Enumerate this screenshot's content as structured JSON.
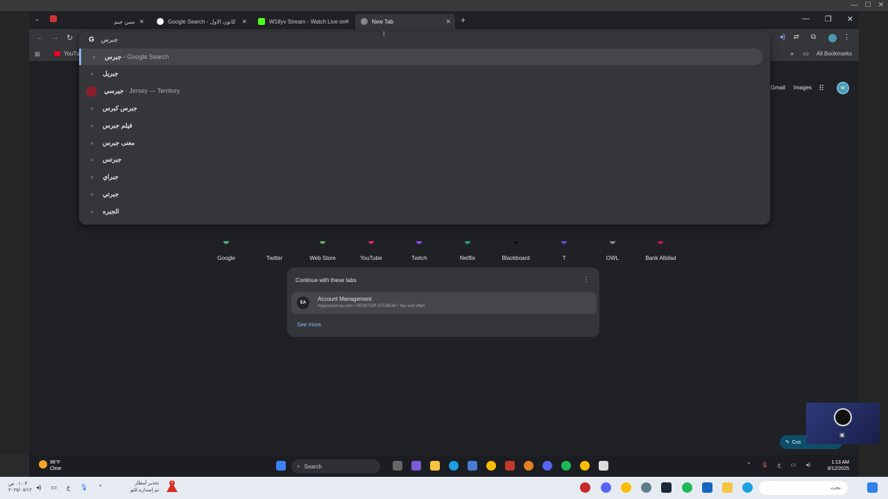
{
  "browser": {
    "tabs": [
      {
        "title": "سين جيم"
      },
      {
        "title": "Google Search - كانون الاول"
      },
      {
        "title": "W18yv Stream - Watch Live on"
      },
      {
        "title": "New Tab"
      }
    ],
    "bookmarks": {
      "youtube": "YouTu",
      "all": "All Bookmarks"
    }
  },
  "omnibox": {
    "query": "جبرس",
    "suggestions": [
      {
        "main": "جبرس",
        "suffix": " - Google Search",
        "icon": "search-icon"
      },
      {
        "main": "جبريل",
        "suffix": "",
        "icon": "search-icon"
      },
      {
        "main": "جيرسي",
        "suffix": " - Jersey — Territory",
        "icon": "flag-icon"
      },
      {
        "main": "جبرس كبرس",
        "suffix": "",
        "icon": "search-icon"
      },
      {
        "main": "فيلم جبرس",
        "suffix": "",
        "icon": "search-icon"
      },
      {
        "main": "معنى جبرس",
        "suffix": "",
        "icon": "search-icon"
      },
      {
        "main": "جبرتس",
        "suffix": "",
        "icon": "search-icon"
      },
      {
        "main": "جبراي",
        "suffix": "",
        "icon": "search-icon"
      },
      {
        "main": "جبرتي",
        "suffix": "",
        "icon": "search-icon"
      },
      {
        "main": "الجبره",
        "suffix": "",
        "icon": "search-icon"
      }
    ]
  },
  "header": {
    "gmail": "Gmail",
    "images": "Images",
    "avatar": "W"
  },
  "shortcuts": [
    {
      "label": "Google",
      "color": "#4caf7a"
    },
    {
      "label": "Twitter",
      "color": "#222222"
    },
    {
      "label": "Web Store",
      "color": "#66aa55"
    },
    {
      "label": "YouTube",
      "color": "#e0245e"
    },
    {
      "label": "Twitch",
      "color": "#9146ff"
    },
    {
      "label": "Netflix",
      "color": "#1aa37a"
    },
    {
      "label": "Blackboard",
      "color": "#111111"
    },
    {
      "label": "T",
      "color": "#5b4fd6"
    },
    {
      "label": "OWL",
      "color": "#888888"
    },
    {
      "label": "Bank Albilad",
      "color": "#c2185b"
    }
  ],
  "continue_card": {
    "title": "Continue with these tabs",
    "item_title": "Account Management",
    "item_sub": "myaccount.ea.com • DESKTOP-O7U9539 • You visit often",
    "ea_label": "EA",
    "see_more": "See more"
  },
  "customize": "Cus",
  "taskbar": {
    "weather_temp": "96°F",
    "weather_desc": "Clear",
    "search": "Search",
    "time": "1:13 AM",
    "date": "8/12/2025",
    "lang": "ع"
  },
  "outer_taskbar": {
    "time": "٠١:٠٣ ص",
    "date": "٢٠٢٥/٠٨/١٢",
    "lang": "ع",
    "news_title": "تحذير أمطار",
    "news_sub": "تم إصداره للتو",
    "badge": "1",
    "search": "بحث"
  }
}
